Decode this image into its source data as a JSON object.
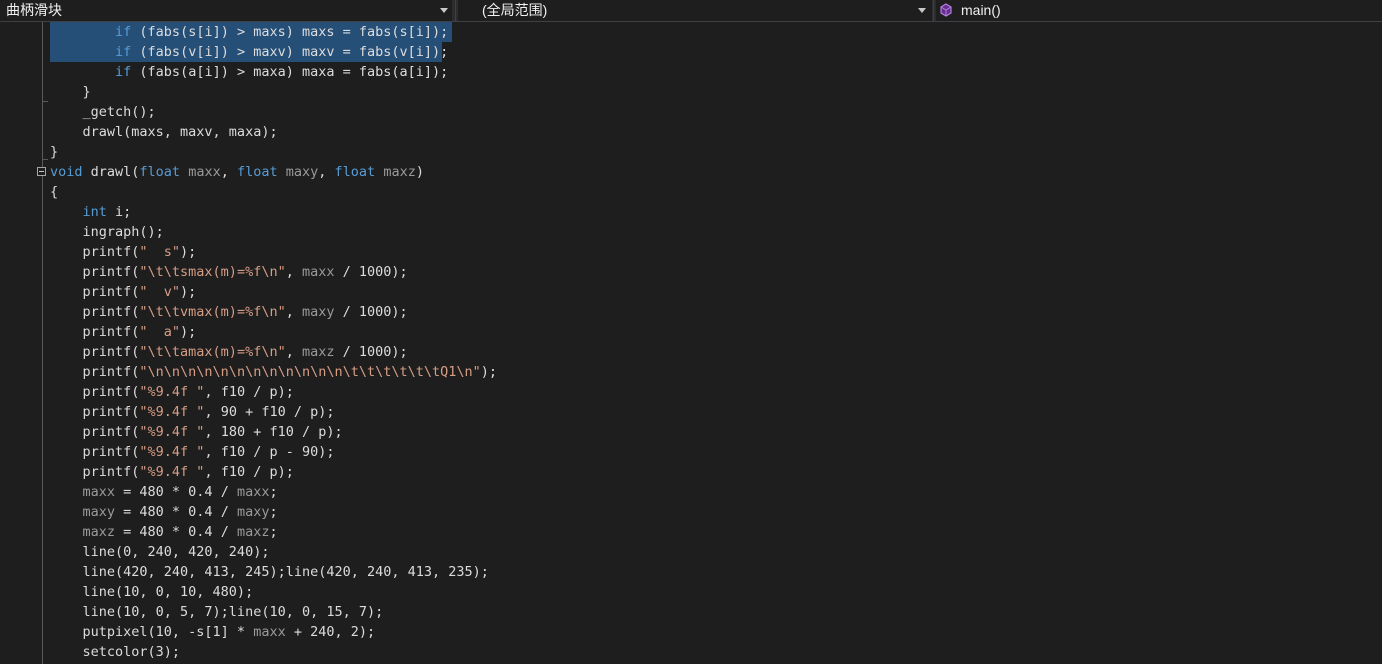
{
  "nav": {
    "project": "曲柄滑块",
    "scope": "(全局范围)",
    "member": "main()"
  },
  "colors": {
    "background": "#1e1e1e",
    "keyword": "#569cd6",
    "string": "#d69d85",
    "parameter": "#9a9a9a",
    "plain": "#dcdcdc",
    "selection": "#264f78"
  },
  "code": {
    "lines": [
      [
        [
          "        ",
          "p"
        ],
        [
          "if",
          "k"
        ],
        [
          " (fabs(s[i]) > maxs) maxs = fabs(s[i]);",
          "p"
        ]
      ],
      [
        [
          "        ",
          "p"
        ],
        [
          "if",
          "k"
        ],
        [
          " (fabs(v[i]) > maxv) maxv = fabs(v[i]);",
          "p"
        ]
      ],
      [
        [
          "        ",
          "p"
        ],
        [
          "if",
          "k"
        ],
        [
          " (fabs(a[i]) > maxa) maxa = fabs(a[i]);",
          "p"
        ]
      ],
      [
        [
          "    }",
          "p"
        ]
      ],
      [
        [
          "    _getch();",
          "p"
        ]
      ],
      [
        [
          "    drawl(maxs, maxv, maxa);",
          "p"
        ]
      ],
      [
        [
          "}",
          "p"
        ]
      ],
      [
        [
          "void",
          "k"
        ],
        [
          " drawl(",
          "p"
        ],
        [
          "float",
          "k"
        ],
        [
          " ",
          "p"
        ],
        [
          "maxx",
          "v"
        ],
        [
          ", ",
          "p"
        ],
        [
          "float",
          "k"
        ],
        [
          " ",
          "p"
        ],
        [
          "maxy",
          "v"
        ],
        [
          ", ",
          "p"
        ],
        [
          "float",
          "k"
        ],
        [
          " ",
          "p"
        ],
        [
          "maxz",
          "v"
        ],
        [
          ")",
          "p"
        ]
      ],
      [
        [
          "{",
          "p"
        ]
      ],
      [
        [
          "    ",
          "p"
        ],
        [
          "int",
          "k"
        ],
        [
          " i;",
          "p"
        ]
      ],
      [
        [
          "    ingraph();",
          "p"
        ]
      ],
      [
        [
          "    printf(",
          "p"
        ],
        [
          "\"  s\"",
          "s"
        ],
        [
          ");",
          "p"
        ]
      ],
      [
        [
          "    printf(",
          "p"
        ],
        [
          "\"\\t\\tsmax(m)=%f\\n\"",
          "s"
        ],
        [
          ", ",
          "p"
        ],
        [
          "maxx",
          "v"
        ],
        [
          " / 1000);",
          "p"
        ]
      ],
      [
        [
          "    printf(",
          "p"
        ],
        [
          "\"  v\"",
          "s"
        ],
        [
          ");",
          "p"
        ]
      ],
      [
        [
          "    printf(",
          "p"
        ],
        [
          "\"\\t\\tvmax(m)=%f\\n\"",
          "s"
        ],
        [
          ", ",
          "p"
        ],
        [
          "maxy",
          "v"
        ],
        [
          " / 1000);",
          "p"
        ]
      ],
      [
        [
          "    printf(",
          "p"
        ],
        [
          "\"  a\"",
          "s"
        ],
        [
          ");",
          "p"
        ]
      ],
      [
        [
          "    printf(",
          "p"
        ],
        [
          "\"\\t\\tamax(m)=%f\\n\"",
          "s"
        ],
        [
          ", ",
          "p"
        ],
        [
          "maxz",
          "v"
        ],
        [
          " / 1000);",
          "p"
        ]
      ],
      [
        [
          "    printf(",
          "p"
        ],
        [
          "\"\\n\\n\\n\\n\\n\\n\\n\\n\\n\\n\\n\\n\\t\\t\\t\\t\\t\\tQ1\\n\"",
          "s"
        ],
        [
          ");",
          "p"
        ]
      ],
      [
        [
          "    printf(",
          "p"
        ],
        [
          "\"%9.4f \"",
          "s"
        ],
        [
          ", f10 / p);",
          "p"
        ]
      ],
      [
        [
          "    printf(",
          "p"
        ],
        [
          "\"%9.4f \"",
          "s"
        ],
        [
          ", 90 + f10 / p);",
          "p"
        ]
      ],
      [
        [
          "    printf(",
          "p"
        ],
        [
          "\"%9.4f \"",
          "s"
        ],
        [
          ", 180 + f10 / p);",
          "p"
        ]
      ],
      [
        [
          "    printf(",
          "p"
        ],
        [
          "\"%9.4f \"",
          "s"
        ],
        [
          ", f10 / p - 90);",
          "p"
        ]
      ],
      [
        [
          "    printf(",
          "p"
        ],
        [
          "\"%9.4f \"",
          "s"
        ],
        [
          ", f10 / p);",
          "p"
        ]
      ],
      [
        [
          "    ",
          "p"
        ],
        [
          "maxx",
          "v"
        ],
        [
          " = 480 * 0.4 / ",
          "p"
        ],
        [
          "maxx",
          "v"
        ],
        [
          ";",
          "p"
        ]
      ],
      [
        [
          "    ",
          "p"
        ],
        [
          "maxy",
          "v"
        ],
        [
          " = 480 * 0.4 / ",
          "p"
        ],
        [
          "maxy",
          "v"
        ],
        [
          ";",
          "p"
        ]
      ],
      [
        [
          "    ",
          "p"
        ],
        [
          "maxz",
          "v"
        ],
        [
          " = 480 * 0.4 / ",
          "p"
        ],
        [
          "maxz",
          "v"
        ],
        [
          ";",
          "p"
        ]
      ],
      [
        [
          "    line(0, 240, 420, 240);",
          "p"
        ]
      ],
      [
        [
          "    line(420, 240, 413, 245);line(420, 240, 413, 235);",
          "p"
        ]
      ],
      [
        [
          "    line(10, 0, 10, 480);",
          "p"
        ]
      ],
      [
        [
          "    line(10, 0, 5, 7);line(10, 0, 15, 7);",
          "p"
        ]
      ],
      [
        [
          "    putpixel(10, -s[1] * ",
          "p"
        ],
        [
          "maxx",
          "v"
        ],
        [
          " + 240, 2);",
          "p"
        ]
      ],
      [
        [
          "    setcolor(3);",
          "p"
        ]
      ]
    ]
  }
}
